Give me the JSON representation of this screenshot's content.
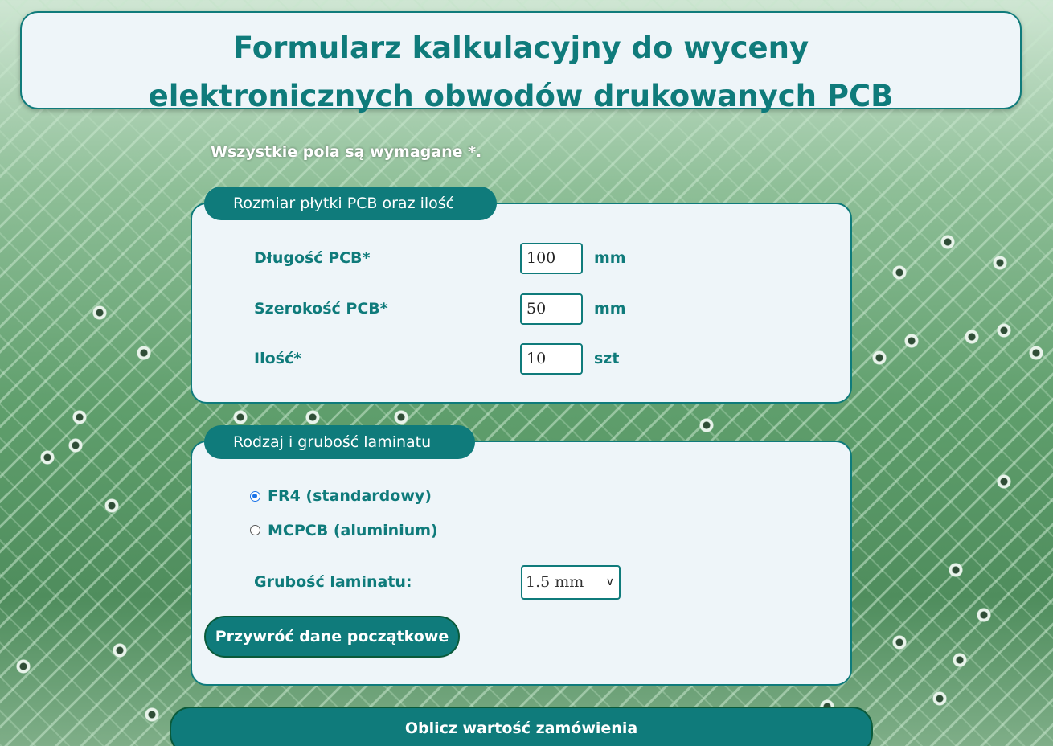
{
  "header": {
    "title_line1": "Formularz kalkulacyjny do wyceny",
    "title_line2": "elektronicznych obwodów drukowanych PCB"
  },
  "required_note": "Wszystkie pola są wymagane *.",
  "section_size": {
    "legend": "Rozmiar płytki PCB oraz ilość",
    "length": {
      "label": "Długość PCB*",
      "value": "100",
      "unit": "mm"
    },
    "width": {
      "label": "Szerokość PCB*",
      "value": "50",
      "unit": "mm"
    },
    "quantity": {
      "label": "Ilość*",
      "value": "10",
      "unit": "szt"
    }
  },
  "section_laminate": {
    "legend": "Rodzaj i grubość laminatu",
    "options": [
      {
        "label": "FR4 (standardowy)",
        "selected": true
      },
      {
        "label": "MCPCB (aluminium)",
        "selected": false
      }
    ],
    "thickness_label": "Grubość laminatu:",
    "thickness_value": "1.5 mm",
    "reset_button": "Przywróć dane początkowe"
  },
  "calculate_button": "Oblicz wartość zamówienia",
  "colors": {
    "accent": "#0f7b7b",
    "panel": "#eef5f9",
    "radio_checked": "#1a73e8"
  },
  "icons": [
    "chevron-down-icon"
  ]
}
